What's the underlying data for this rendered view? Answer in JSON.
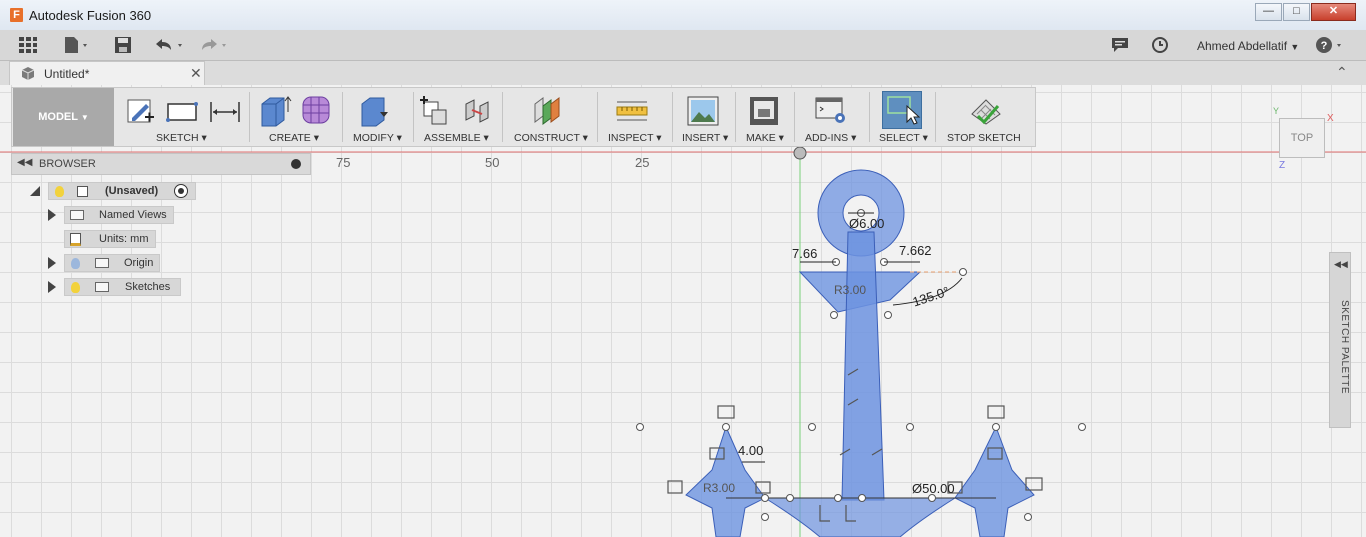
{
  "window": {
    "title": "Autodesk Fusion 360",
    "logo_letter": "F"
  },
  "quick_toolbar": {
    "user_name": "Ahmed Abdellatif"
  },
  "document_tab": {
    "label": "Untitled*"
  },
  "ribbon": {
    "model_label": "MODEL",
    "groups": [
      {
        "label": "SKETCH"
      },
      {
        "label": "CREATE"
      },
      {
        "label": "MODIFY"
      },
      {
        "label": "ASSEMBLE"
      },
      {
        "label": "CONSTRUCT"
      },
      {
        "label": "INSPECT"
      },
      {
        "label": "INSERT"
      },
      {
        "label": "MAKE"
      },
      {
        "label": "ADD-INS"
      },
      {
        "label": "SELECT"
      },
      {
        "label": "STOP SKETCH"
      }
    ]
  },
  "browser": {
    "title": "BROWSER",
    "root": "(Unsaved)",
    "items": [
      "Named Views",
      "Units: mm",
      "Origin",
      "Sketches"
    ]
  },
  "ruler": {
    "ticks": [
      "75",
      "50",
      "25"
    ]
  },
  "view_cube": {
    "face": "TOP",
    "axis_x": "X",
    "axis_y": "Y",
    "axis_z": "Z"
  },
  "sketch_palette": {
    "label": "SKETCH PALETTE"
  },
  "dimensions": {
    "hole_diameter": "Ø6.00",
    "left_width": "7.66",
    "right_width": "7.662",
    "angle": "135.0°",
    "small_width": "4.00",
    "arc_diameter": "Ø50.00",
    "r_label_1": "R3.00",
    "r_label_2": "R3.00"
  },
  "colors": {
    "accent_active": "#5f8fbf",
    "sketch_fill": "#6d93e0",
    "sketch_stroke": "#3b5fb8"
  }
}
